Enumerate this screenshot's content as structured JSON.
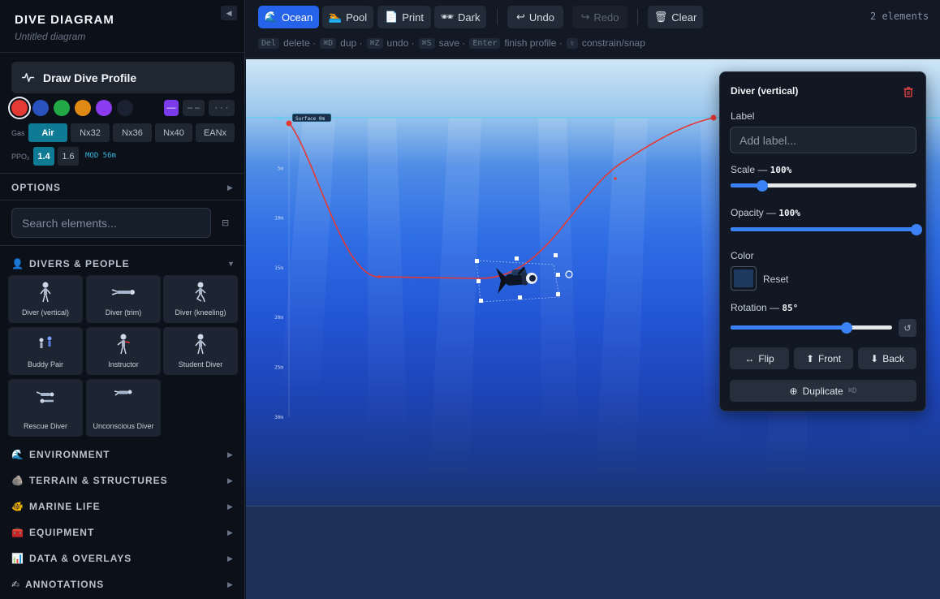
{
  "sidebar": {
    "title": "DIVE DIAGRAM",
    "subtitle": "Untitled diagram",
    "draw_button": "Draw Dive Profile",
    "swatches": [
      "#e53935",
      "#2a52be",
      "#22a845",
      "#e08a14",
      "#8b3bf0",
      "#1a2130"
    ],
    "line_styles": [
      "—",
      "– –",
      "· · ·"
    ],
    "gas_label": "Gas",
    "gases": [
      "Air",
      "Nx32",
      "Nx36",
      "Nx40",
      "EANx"
    ],
    "ppo2_label": "PPO₂",
    "ppo2": [
      "1.4",
      "1.6"
    ],
    "mod": "MOD 56m",
    "options": "OPTIONS",
    "search_placeholder": "Search elements...",
    "divers_section": "DIVERS & PEOPLE",
    "tiles": [
      "Diver (vertical)",
      "Diver (trim)",
      "Diver (kneeling)",
      "Buddy Pair",
      "Instructor",
      "Student Diver",
      "Rescue Diver",
      "Unconscious Diver"
    ],
    "sections": [
      {
        "icon": "🌊",
        "label": "ENVIRONMENT"
      },
      {
        "icon": "🪨",
        "label": "TERRAIN & STRUCTURES"
      },
      {
        "icon": "🐠",
        "label": "MARINE LIFE"
      },
      {
        "icon": "🧰",
        "label": "EQUIPMENT"
      },
      {
        "icon": "📊",
        "label": "DATA & OVERLAYS"
      },
      {
        "icon": "✍",
        "label": "ANNOTATIONS"
      }
    ]
  },
  "toolbar": {
    "ocean": "Ocean",
    "pool": "Pool",
    "print": "Print",
    "dark": "Dark",
    "undo": "Undo",
    "redo": "Redo",
    "clear": "Clear",
    "count": "2 elements",
    "hints": [
      {
        "k": "Del",
        "t": "delete ·"
      },
      {
        "k": "⌘D",
        "t": "dup ·"
      },
      {
        "k": "⌘Z",
        "t": "undo ·"
      },
      {
        "k": "⌘S",
        "t": "save ·"
      },
      {
        "k": "Enter",
        "t": "finish profile ·"
      },
      {
        "k": "⇧",
        "t": "constrain/snap"
      }
    ]
  },
  "canvas": {
    "surface_label": "Surface  0m",
    "depth_labels": [
      "0m",
      "5m",
      "10m",
      "15m",
      "20m",
      "25m",
      "30m"
    ],
    "profile_color": "#e53935"
  },
  "panel": {
    "title": "Diver (vertical)",
    "label_heading": "Label",
    "label_placeholder": "Add label...",
    "scale_label": "Scale —",
    "scale_value": "100%",
    "scale_fraction": 0.17,
    "opacity_label": "Opacity —",
    "opacity_value": "100%",
    "opacity_fraction": 1.0,
    "color_label": "Color",
    "color_value": "#1e3a5f",
    "reset": "Reset",
    "rotation_label": "Rotation —",
    "rotation_value": "85°",
    "rotation_fraction": 0.72,
    "flip": "Flip",
    "front": "Front",
    "back": "Back",
    "duplicate": "Duplicate",
    "duplicate_key": "⌘D"
  }
}
